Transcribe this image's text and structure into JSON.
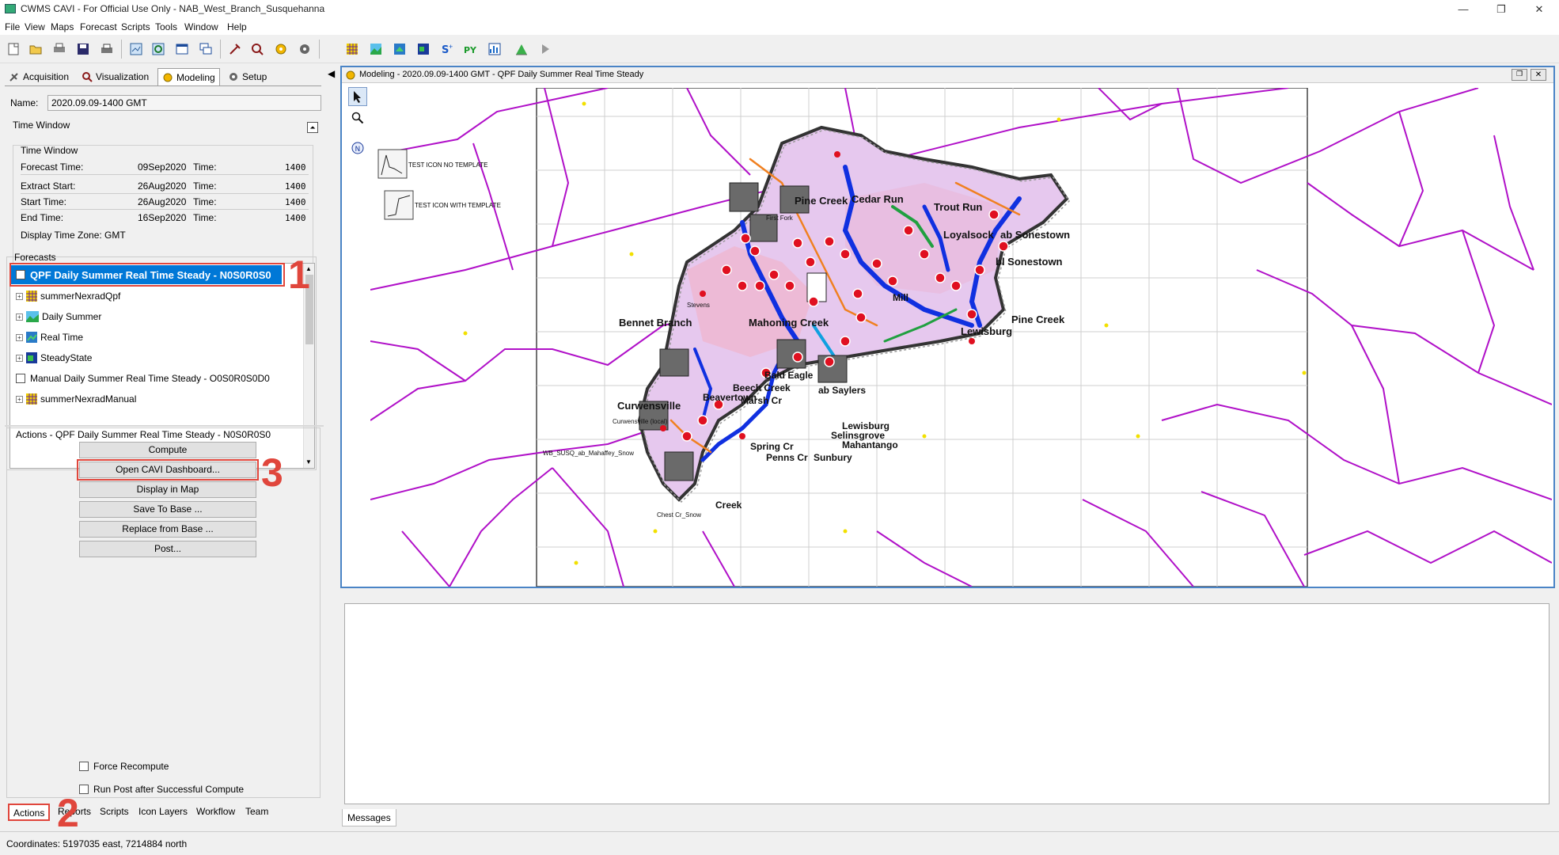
{
  "window": {
    "title": "CWMS CAVI - For Official Use Only  - NAB_West_Branch_Susquehanna",
    "minimize": "—",
    "restore": "❐",
    "close": "✕"
  },
  "menu": [
    "File",
    "View",
    "Maps",
    "Forecast",
    "Scripts",
    "Tools",
    "Window",
    "Help"
  ],
  "toolbar_icons": [
    "new-icon",
    "open-icon",
    "print-setup-icon",
    "save-icon",
    "print-icon",
    "map-export-icon",
    "refresh-icon",
    "window-icon",
    "cascade-icon",
    "tools-icon",
    "tools2-icon",
    "gear-yellow-icon",
    "gear-icon",
    "grid-icon",
    "terrain-icon",
    "layers-icon",
    "globe-icon",
    "script-plus-icon",
    "python-icon",
    "chart-icon",
    "hydrograph-icon",
    "run-icon"
  ],
  "left_tabs": [
    {
      "label": "Acquisition",
      "icon": "satellite-icon"
    },
    {
      "label": "Visualization",
      "icon": "visualization-icon"
    },
    {
      "label": "Modeling",
      "icon": "modeling-icon"
    },
    {
      "label": "Setup",
      "icon": "setup-gear-icon"
    }
  ],
  "name_label": "Name:",
  "name_value": "2020.09.09-1400 GMT",
  "time_window_header": "Time Window",
  "time_window_group": "Time Window",
  "time_rows": [
    {
      "label": "Forecast Time:",
      "date": "09Sep2020",
      "time_label": "Time:",
      "time": "1400"
    },
    {
      "label": "Extract Start:",
      "date": "26Aug2020",
      "time_label": "Time:",
      "time": "1400"
    },
    {
      "label": "Start Time:",
      "date": "26Aug2020",
      "time_label": "Time:",
      "time": "1400"
    },
    {
      "label": "End Time:",
      "date": "16Sep2020",
      "time_label": "Time:",
      "time": "1400"
    }
  ],
  "display_tz": "Display Time Zone:  GMT",
  "forecasts_label": "Forecasts",
  "forecasts": [
    {
      "label": "QPF Daily Summer Real Time Steady - N0S0R0S0",
      "type": "checkbox",
      "selected": true
    },
    {
      "label": "summerNexradQpf",
      "type": "node",
      "icon": "grid-icon"
    },
    {
      "label": "Daily Summer",
      "type": "node",
      "icon": "terrain-icon"
    },
    {
      "label": "Real Time",
      "type": "node",
      "icon": "realtime-icon"
    },
    {
      "label": "SteadyState",
      "type": "node",
      "icon": "steady-icon"
    },
    {
      "label": "Manual Daily Summer Real Time Steady - O0S0R0S0D0",
      "type": "checkbox",
      "selected": false
    },
    {
      "label": "summerNexradManual",
      "type": "node",
      "icon": "grid-icon"
    }
  ],
  "actions_title": "Actions - QPF Daily Summer Real Time Steady - N0S0R0S0",
  "actions": [
    "Compute",
    "Open CAVI Dashboard...",
    "Display in Map",
    "Save To Base ...",
    "Replace from Base ...",
    "Post..."
  ],
  "options": [
    "Force Recompute",
    "Run Post after Successful Compute"
  ],
  "bottom_tabs": [
    "Actions",
    "Reports",
    "Scripts",
    "Icon Layers",
    "Workflow",
    "Team"
  ],
  "callouts": [
    "1",
    "2",
    "3"
  ],
  "map_window": {
    "title": "Modeling - 2020.09.09-1400 GMT - QPF Daily Summer Real Time Steady",
    "legend": [
      "TEST ICON NO TEMPLATE",
      "TEST ICON WITH TEMPLATE"
    ],
    "labels": [
      "Pine Creek",
      "Cedar Run",
      "Trout Run",
      "Loyalsock",
      "ab Sonestown",
      "bl Sonestown",
      "Bennet Branch",
      "Mahoning Creek",
      "Pine Creek",
      "Lewisburg",
      "Curwensville",
      "Curwensville (local)",
      "WB_SUSQ_ab_Mahaffey_Snow",
      "Spring Cr",
      "Penns Cr",
      "Beavertown",
      "ab Saylers",
      "Lewisburg",
      "Selinsgrove",
      "Mahantango",
      "Sunbury",
      "Chest Cr_Snow",
      "First Fork",
      "Stevens",
      "Mill",
      "Beech Creek",
      "Marsh Cr",
      "Bald Eagle",
      "Creek"
    ],
    "colors": {
      "border": "#b010c8",
      "basin_fill": "#e6c8ee",
      "stream": "#1030e0",
      "orange": "#f08020",
      "green": "#20a040",
      "node": "#e01020"
    }
  },
  "messages_tab": "Messages",
  "status": "Coordinates: 5197035 east, 7214884 north"
}
